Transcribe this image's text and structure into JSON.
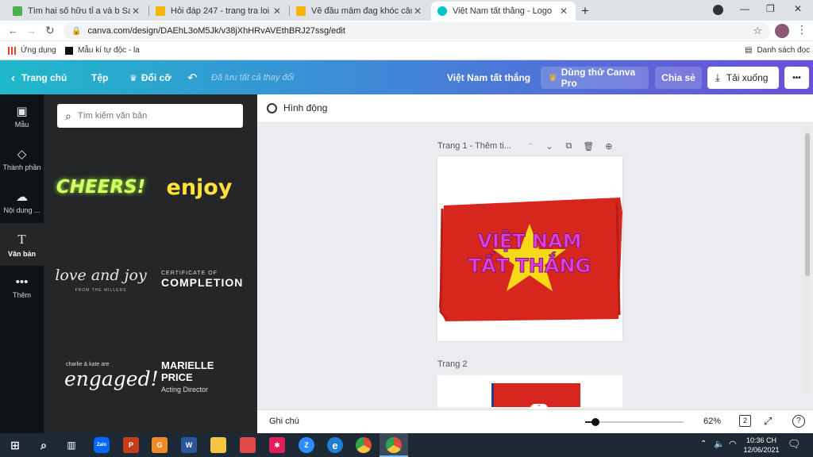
{
  "browser": {
    "tabs": [
      {
        "title": "Tìm hai số hữu tỉ a và b Sao cho",
        "favicon_color": "#4caf50",
        "active": false
      },
      {
        "title": "Hỏi đáp 247 - trang tra loi",
        "favicon_color": "#f4b400",
        "active": false
      },
      {
        "title": "Vẽ đầu mâm đag khóc câu hỏi 2",
        "favicon_color": "#f4b400",
        "active": false
      },
      {
        "title": "Việt Nam tất thắng - Logo",
        "favicon_color": "#00c4cc",
        "active": true
      }
    ],
    "new_tab_label": "+",
    "url": "canva.com/design/DAEhL3oM5Jk/v38jXhHRvAVEthBRJ27ssg/edit",
    "bookmarks": [
      {
        "label": "Ứng dụng",
        "icon": "apps-grid-icon"
      },
      {
        "label": "Mẫu kí tự độc - la",
        "icon": "bookmark-icon"
      }
    ],
    "reading_list_label": "Danh sách đọc"
  },
  "header": {
    "home": "Trang chủ",
    "file": "Tệp",
    "resize": "Đổi cỡ",
    "saved": "Đã lưu tất cả thay đổi",
    "design_title": "Việt Nam tất thắng",
    "try_pro": "Dùng thử Canva Pro",
    "share": "Chia sẻ",
    "download": "Tải xuống",
    "more": "•••",
    "accent": "#7d2ae8"
  },
  "rail": [
    {
      "label": "Mẫu",
      "icon": "template-icon"
    },
    {
      "label": "Thành phần",
      "icon": "elements-icon"
    },
    {
      "label": "Nội dung ...",
      "icon": "upload-icon"
    },
    {
      "label": "Văn bản",
      "icon": "text-icon",
      "active": true
    },
    {
      "label": "Thêm",
      "icon": "more-icon"
    }
  ],
  "panel": {
    "search_placeholder": "Tìm kiếm văn bản",
    "cards": [
      {
        "main": "CHEERS!"
      },
      {
        "main": "enjoy"
      },
      {
        "main": "love and joy",
        "sub": "FROM THE MILLERS"
      },
      {
        "top": "CERTIFICATE OF",
        "main": "COMPLETION"
      },
      {
        "top": "charlie & kate are",
        "main": "engaged!"
      },
      {
        "main": "MARIELLE PRICE",
        "sub": "Acting Director"
      }
    ]
  },
  "workspace": {
    "animate": "Hình động",
    "page1_label": "Trang 1 - Thêm ti...",
    "page2_label": "Trang 2",
    "logo_line1": "VIỆT NAM",
    "logo_line2": "TẤT THẮNG",
    "flag_red": "#d7261e",
    "star_yellow": "#f7d917",
    "text_magenta": "#e23ed9"
  },
  "footer": {
    "notes": "Ghi chú",
    "zoom": "62%",
    "zoom_fraction": 0.12,
    "page_count": "2",
    "help": "?"
  },
  "taskbar": {
    "time": "10:36 CH",
    "date": "12/06/2021",
    "apps": [
      {
        "name": "start",
        "color": "#ffffff"
      },
      {
        "name": "search",
        "color": "#ffffff"
      },
      {
        "name": "task-view",
        "color": "#ffffff"
      },
      {
        "name": "zalo",
        "label": "Zalo",
        "color": "#0068ff"
      },
      {
        "name": "powerpoint",
        "label": "P",
        "color": "#c43e1c"
      },
      {
        "name": "app-orange",
        "label": "G",
        "color": "#f28a25"
      },
      {
        "name": "word",
        "label": "W",
        "color": "#2b579a"
      },
      {
        "name": "file-explorer",
        "label": "",
        "color": "#f4c542"
      },
      {
        "name": "app-store",
        "label": "",
        "color": "#e24a4a"
      },
      {
        "name": "slack",
        "label": "✱",
        "color": "#e01e5a"
      },
      {
        "name": "zoom",
        "label": "Z",
        "color": "#2d8cff"
      },
      {
        "name": "edge",
        "label": "e",
        "color": "#1f7fd8"
      },
      {
        "name": "chrome",
        "label": "",
        "color": "#dd4b39"
      },
      {
        "name": "chrome-active",
        "label": "",
        "color": "#dd4b39"
      }
    ]
  }
}
